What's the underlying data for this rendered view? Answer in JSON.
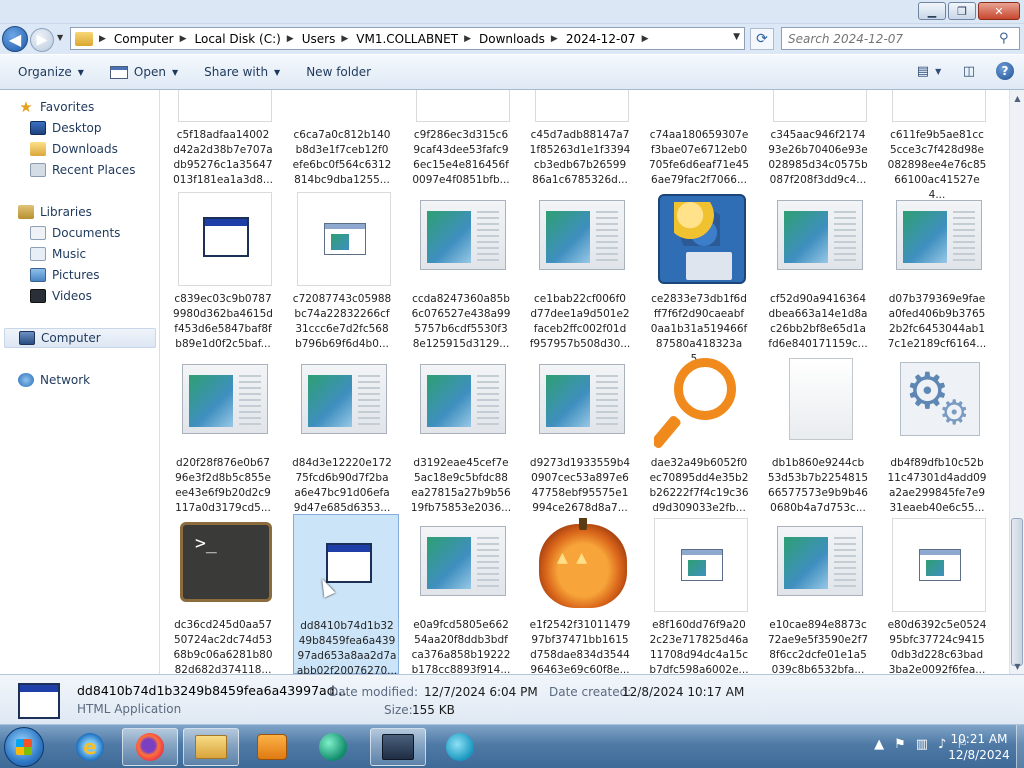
{
  "window": {
    "minimize": "▁",
    "maximize": "❐",
    "close": "✕"
  },
  "address": {
    "crumbs": [
      "Computer",
      "Local Disk (C:)",
      "Users",
      "VM1.COLLABNET",
      "Downloads",
      "2024-12-07"
    ],
    "search_placeholder": "Search 2024-12-07"
  },
  "toolbar": {
    "organize": "Organize",
    "open": "Open",
    "share_with": "Share with",
    "new_folder": "New folder",
    "help": "?"
  },
  "nav": {
    "favorites": "Favorites",
    "desktop": "Desktop",
    "downloads": "Downloads",
    "recent_places": "Recent Places",
    "libraries": "Libraries",
    "documents": "Documents",
    "music": "Music",
    "pictures": "Pictures",
    "videos": "Videos",
    "computer": "Computer",
    "network": "Network"
  },
  "files": [
    {
      "name": "c5f18adfaa14002\nd42a2d38b7e707a\ndb95276c1a35647\n013f181ea1a3d8...",
      "icon": "app-window-icon"
    },
    {
      "name": "c6ca7a0c812b140\nb8d3e1f7ceb12f0\nefe6bc0f564c6312\n814bc9dba1255...",
      "icon": "pdf-icon"
    },
    {
      "name": "c9f286ec3d315c6\n9caf43dee53fafc9\n6ec15e4e816456f\n0097e4f0851bfb...",
      "icon": "document-icon"
    },
    {
      "name": "c45d7adb88147a7\n1f85263d1e1f3394\ncb3edb67b26599\n86a1c6785326d...",
      "icon": "document-icon"
    },
    {
      "name": "c74aa180659307e\nf3bae07e6712eb0\n705fe6d6eaf71e45\n6ae79fac2f7066...",
      "icon": "zip-folder-icon"
    },
    {
      "name": "c345aac946f2174\n93e26b70406e93e\n028985d34c0575b\n087f208f3dd9c4...",
      "icon": "document-icon"
    },
    {
      "name": "c611fe9b5ae81cc\n5cce3c7f428d98e\n082898ee4e76c85\n66100ac41527e4...",
      "icon": "document-icon"
    },
    {
      "name": "c839ec03c9b0787\n9980d362ba4615d\nf453d6e5847baf8f\nb89e1d0f2c5baf...",
      "icon": "app-window-icon"
    },
    {
      "name": "c72087743c05988\nbc74a22832266cf\n31ccc6e7d2fc568\nb796b69f6d4b0...",
      "icon": "html-app-icon"
    },
    {
      "name": "ccda8247360a85b\n6c076527e438a99\n5757b6cdf5530f3\n8e125915d3129...",
      "icon": "document-icon"
    },
    {
      "name": "ce1bab22cf006f0\nd77dee1a9d501e2\nfaceb2ffc002f01d\nf957957b508d30...",
      "icon": "document-icon"
    },
    {
      "name": "ce2833e73db1f6d\nff7f6f2d90caeabf\n0aa1b31a519466f\n87580a418323a5...",
      "icon": "python-icon"
    },
    {
      "name": "cf52d90a9416364\ndbea663a14e1d8a\nc26bb2bf8e65d1a\nfd6e840171159c...",
      "icon": "document-icon"
    },
    {
      "name": "d07b379369e9fae\na0fed406b9b3765\n2b2fc6453044ab1\n7c1e2189cf6164...",
      "icon": "document-icon"
    },
    {
      "name": "d20f28f876e0b67\n96e3f2d8b5c855e\nee43e6f9b20d2c9\n117a0d3179cd5...",
      "icon": "document-icon"
    },
    {
      "name": "d84d3e12220e172\n75fcd6b90d7f2ba\na6e47bc91d06efa\n9d47e685d6353...",
      "icon": "document-icon"
    },
    {
      "name": "d3192eae45cef7e\n5ac18e9c5bfdc88\nea27815a27b9b56\n19fb75853e2036...",
      "icon": "document-icon"
    },
    {
      "name": "d9273d1933559b4\n0907cec53a897e6\n47758ebf95575e1\n994ce2678d8a7...",
      "icon": "document-icon"
    },
    {
      "name": "dae32a49b6052f0\nec70895dd4e35b2\nb26222f7f4c19c36\nd9d309033e2fb...",
      "icon": "magnifier-icon"
    },
    {
      "name": "db1b860e9244cb\n53d53b7b2254815\n66577573e9b9b46\n0680b4a7d753c...",
      "icon": "blank-file-icon"
    },
    {
      "name": "db4f89dfb10c52b\n11c47301d4add09\na2ae299845fe7e9\n31eaeb40e6c55...",
      "icon": "gears-icon"
    },
    {
      "name": "dc36cd245d0aa57\n50724ac2dc74d53\n68b9c06a6281b80\n82d682d374118...",
      "icon": "console-icon"
    },
    {
      "name": "dd8410b74d1b32\n49b8459fea6a439\n97ad653a8aa2d7a\nabb02f20076270...",
      "icon": "app-window-icon"
    },
    {
      "name": "e0a9fcd5805e662\n54aa20f8ddb3bdf\nca376a858b19222\nb178cc8893f914...",
      "icon": "document-icon"
    },
    {
      "name": "e1f2542f31011479\n97bf37471bb1615\nd758dae834d3544\n96463e69c60f8e...",
      "icon": "pumpkin-icon"
    },
    {
      "name": "e8f160dd76f9a20\n2c23e717825d46a\n11708d94dc4a15c\nb7dfc598a6002e...",
      "icon": "html-app-icon"
    },
    {
      "name": "e10cae894e8873c\n72ae9e5f3590e2f7\n8f6cc2dcfe01e1a5\n039c8b6532bfa...",
      "icon": "document-icon"
    },
    {
      "name": "e80d6392c5e0524\n95bfc37724c9415\n0db3d228c63bad\n3ba2e0092f6fea...",
      "icon": "html-app-icon"
    }
  ],
  "details": {
    "name": "dd8410b74d1b3249b8459fea6a43997ad...",
    "type": "HTML Application",
    "modified_label": "Date modified:",
    "modified": "12/7/2024 6:04 PM",
    "created_label": "Date created:",
    "created": "12/8/2024 10:17 AM",
    "size_label": "Size:",
    "size": "155 KB"
  },
  "taskbar": {
    "time": "10:21 AM",
    "date": "12/8/2024"
  }
}
